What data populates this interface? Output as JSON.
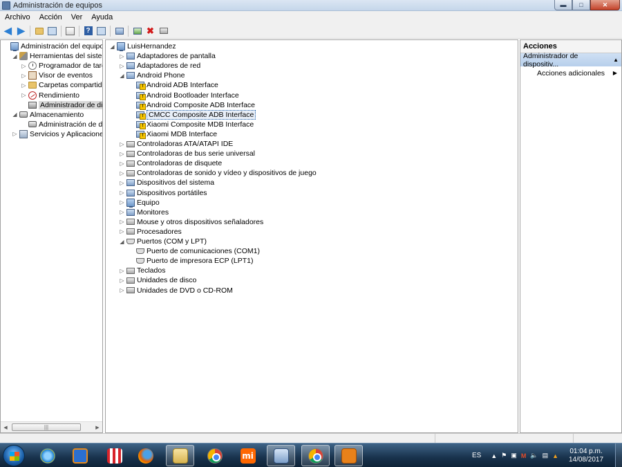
{
  "window": {
    "title": "Administración de equipos",
    "controls": [
      "minimize",
      "maximize",
      "close"
    ]
  },
  "menu": [
    "Archivo",
    "Acción",
    "Ver",
    "Ayuda"
  ],
  "left_tree": [
    {
      "label": "Administración del equipo (loc",
      "level": 0,
      "expander": "",
      "icon": "computer-icon"
    },
    {
      "label": "Herramientas del sistema",
      "level": 1,
      "expander": "open",
      "icon": "tools-icon"
    },
    {
      "label": "Programador de tareas",
      "level": 2,
      "expander": "closed",
      "icon": "clock-icon"
    },
    {
      "label": "Visor de eventos",
      "level": 2,
      "expander": "closed",
      "icon": "event-log-icon"
    },
    {
      "label": "Carpetas compartidas",
      "level": 2,
      "expander": "closed",
      "icon": "folder-icon"
    },
    {
      "label": "Rendimiento",
      "level": 2,
      "expander": "closed",
      "icon": "performance-icon"
    },
    {
      "label": "Administrador de dispo",
      "level": 2,
      "expander": "",
      "icon": "device-manager-icon",
      "selected": true
    },
    {
      "label": "Almacenamiento",
      "level": 1,
      "expander": "open",
      "icon": "storage-icon"
    },
    {
      "label": "Administración de disco",
      "level": 2,
      "expander": "",
      "icon": "disk-icon"
    },
    {
      "label": "Servicios y Aplicaciones",
      "level": 1,
      "expander": "closed",
      "icon": "services-icon"
    }
  ],
  "device_tree": [
    {
      "label": "LuisHernandez",
      "level": 0,
      "expander": "open",
      "icon": "computer-icon"
    },
    {
      "label": "Adaptadores de pantalla",
      "level": 1,
      "expander": "closed",
      "icon": "display-adapter-icon"
    },
    {
      "label": "Adaptadores de red",
      "level": 1,
      "expander": "closed",
      "icon": "network-adapter-icon"
    },
    {
      "label": "Android Phone",
      "level": 1,
      "expander": "open",
      "icon": "phone-device-icon"
    },
    {
      "label": "Android ADB Interface",
      "level": 2,
      "expander": "",
      "icon": "device-warning-icon"
    },
    {
      "label": "Android Bootloader Interface",
      "level": 2,
      "expander": "",
      "icon": "device-warning-icon"
    },
    {
      "label": "Android Composite ADB Interface",
      "level": 2,
      "expander": "",
      "icon": "device-warning-icon"
    },
    {
      "label": "CMCC Composite ADB Interface",
      "level": 2,
      "expander": "",
      "icon": "device-warning-icon",
      "selected": true
    },
    {
      "label": "Xiaomi Composite MDB Interface",
      "level": 2,
      "expander": "",
      "icon": "device-warning-icon"
    },
    {
      "label": "Xiaomi MDB Interface",
      "level": 2,
      "expander": "",
      "icon": "device-warning-icon"
    },
    {
      "label": "Controladoras ATA/ATAPI IDE",
      "level": 1,
      "expander": "closed",
      "icon": "ide-controller-icon"
    },
    {
      "label": "Controladoras de bus serie universal",
      "level": 1,
      "expander": "closed",
      "icon": "usb-icon"
    },
    {
      "label": "Controladoras de disquete",
      "level": 1,
      "expander": "closed",
      "icon": "floppy-icon"
    },
    {
      "label": "Controladoras de sonido y vídeo y dispositivos de juego",
      "level": 1,
      "expander": "closed",
      "icon": "sound-icon"
    },
    {
      "label": "Dispositivos del sistema",
      "level": 1,
      "expander": "closed",
      "icon": "system-device-icon"
    },
    {
      "label": "Dispositivos portátiles",
      "level": 1,
      "expander": "closed",
      "icon": "portable-device-icon"
    },
    {
      "label": "Equipo",
      "level": 1,
      "expander": "closed",
      "icon": "computer-icon"
    },
    {
      "label": "Monitores",
      "level": 1,
      "expander": "closed",
      "icon": "monitor-icon"
    },
    {
      "label": "Mouse y otros dispositivos señaladores",
      "level": 1,
      "expander": "closed",
      "icon": "mouse-icon"
    },
    {
      "label": "Procesadores",
      "level": 1,
      "expander": "closed",
      "icon": "processor-icon"
    },
    {
      "label": "Puertos (COM y LPT)",
      "level": 1,
      "expander": "open",
      "icon": "port-icon"
    },
    {
      "label": "Puerto de comunicaciones (COM1)",
      "level": 2,
      "expander": "",
      "icon": "port-icon"
    },
    {
      "label": "Puerto de impresora ECP (LPT1)",
      "level": 2,
      "expander": "",
      "icon": "port-icon"
    },
    {
      "label": "Teclados",
      "level": 1,
      "expander": "closed",
      "icon": "keyboard-icon"
    },
    {
      "label": "Unidades de disco",
      "level": 1,
      "expander": "closed",
      "icon": "disk-drive-icon"
    },
    {
      "label": "Unidades de DVD o CD-ROM",
      "level": 1,
      "expander": "closed",
      "icon": "dvd-icon"
    }
  ],
  "actions": {
    "header": "Acciones",
    "section": "Administrador de dispositiv...",
    "item": "Acciones adicionales"
  },
  "taskbar": {
    "apps": [
      "internet-explorer-icon",
      "media-player-icon",
      "popcorn-icon",
      "firefox-icon",
      "file-explorer-icon",
      "chrome-icon",
      "mi-icon",
      "device-manager-icon",
      "chrome-icon",
      "package-icon"
    ],
    "active_index": 7,
    "language": "ES",
    "time": "01:04 p.m.",
    "date": "14/08/2017"
  },
  "colors": {
    "selection": "#e8eff8",
    "actions_section": "#c6d9f0",
    "taskbar": "#18324c"
  }
}
